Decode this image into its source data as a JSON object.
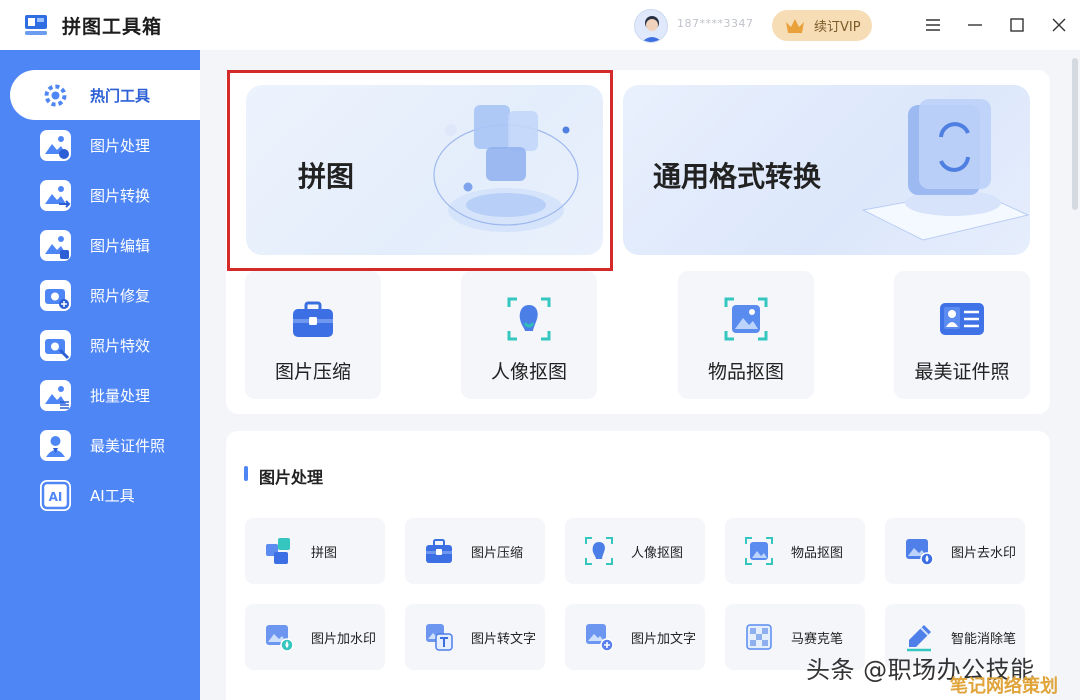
{
  "app": {
    "title": "拼图工具箱",
    "username": "187****3347",
    "vip_label": "续订VIP"
  },
  "sidebar": {
    "items": [
      {
        "label": "热门工具",
        "icon": "gear-icon",
        "active": true
      },
      {
        "label": "图片处理",
        "icon": "image-process-icon"
      },
      {
        "label": "图片转换",
        "icon": "image-convert-icon"
      },
      {
        "label": "图片编辑",
        "icon": "image-edit-icon"
      },
      {
        "label": "照片修复",
        "icon": "photo-repair-icon"
      },
      {
        "label": "照片特效",
        "icon": "photo-effect-icon"
      },
      {
        "label": "批量处理",
        "icon": "batch-process-icon"
      },
      {
        "label": "最美证件照",
        "icon": "id-photo-icon"
      },
      {
        "label": "AI工具",
        "icon": "ai-icon"
      }
    ]
  },
  "hot": {
    "banners": [
      {
        "title": "拼图"
      },
      {
        "title": "通用格式转换"
      }
    ],
    "tools": [
      {
        "label": "图片压缩",
        "icon": "toolbox-icon"
      },
      {
        "label": "人像抠图",
        "icon": "portrait-cutout-icon"
      },
      {
        "label": "物品抠图",
        "icon": "object-cutout-icon"
      },
      {
        "label": "最美证件照",
        "icon": "id-card-icon"
      }
    ]
  },
  "image_section": {
    "title": "图片处理",
    "row1": [
      {
        "label": "拼图",
        "icon": "puzzle-icon"
      },
      {
        "label": "图片压缩",
        "icon": "toolbox-icon"
      },
      {
        "label": "人像抠图",
        "icon": "portrait-cutout-icon"
      },
      {
        "label": "物品抠图",
        "icon": "object-cutout-icon"
      },
      {
        "label": "图片去水印",
        "icon": "remove-watermark-icon"
      }
    ],
    "row2": [
      {
        "label": "图片加水印",
        "icon": "add-watermark-icon"
      },
      {
        "label": "图片转文字",
        "icon": "image-to-text-icon"
      },
      {
        "label": "图片加文字",
        "icon": "add-text-icon"
      },
      {
        "label": "马赛克笔",
        "icon": "mosaic-icon"
      },
      {
        "label": "智能消除笔",
        "icon": "eraser-pen-icon"
      }
    ]
  },
  "watermark": {
    "text": "头条 @职场办公技能",
    "text2": "笔记网络策划"
  },
  "colors": {
    "sidebar_bg": "#4f86f5",
    "accent": "#2c5fd6",
    "highlight": "#d42a2a",
    "vip_bg": "#f6ddb6"
  }
}
